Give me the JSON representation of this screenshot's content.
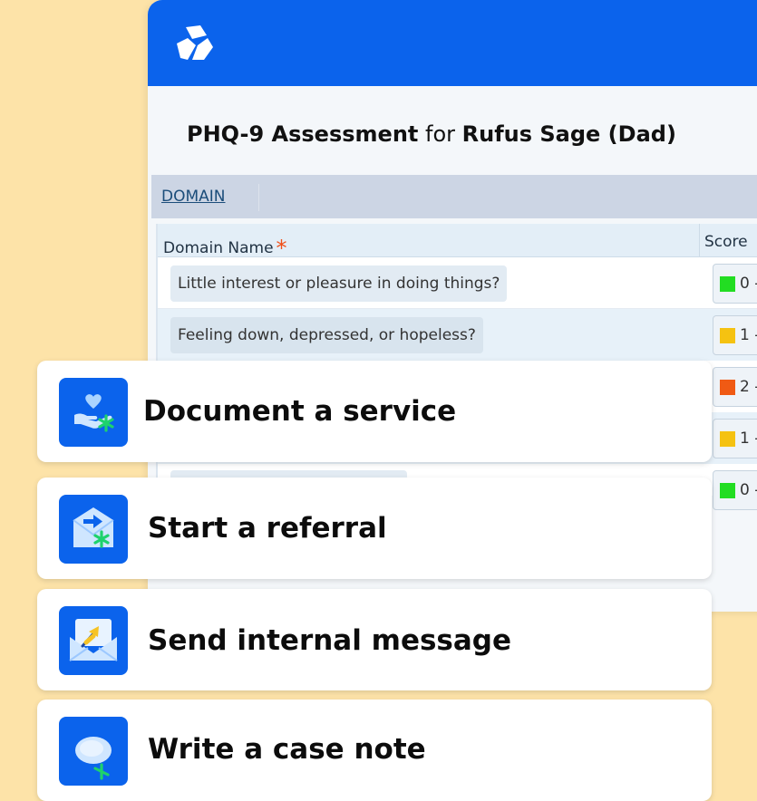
{
  "app": {
    "title_assessment": "PHQ-9 Assessment",
    "title_for": "for",
    "title_patient": "Rufus Sage (Dad)",
    "domain_tab": "DOMAIN",
    "columns": {
      "name": "Domain Name",
      "required_marker": "*",
      "score": "Score"
    },
    "rows": [
      {
        "question": "Little interest or pleasure in doing things?",
        "score": "0 -",
        "color": "#22dd22"
      },
      {
        "question": "Feeling down, depressed, or hopeless?",
        "score": "1 -",
        "color": "#f5c211"
      },
      {
        "question": "",
        "score": "2 -",
        "color": "#f05a14"
      },
      {
        "question": "",
        "score": "1 -",
        "color": "#f5c211"
      },
      {
        "question": "",
        "score": "0 -",
        "color": "#22dd22"
      }
    ]
  },
  "actions": [
    {
      "label": "Document a service",
      "icon": "hand-heart-icon"
    },
    {
      "label": "Start a referral",
      "icon": "referral-envelope-icon"
    },
    {
      "label": "Send internal message",
      "icon": "message-envelope-icon"
    },
    {
      "label": "Write a case note",
      "icon": "chat-bubble-icon"
    }
  ],
  "colors": {
    "background": "#fde3a8",
    "brand_blue": "#0b63ec",
    "accent_green": "#19c36a"
  }
}
